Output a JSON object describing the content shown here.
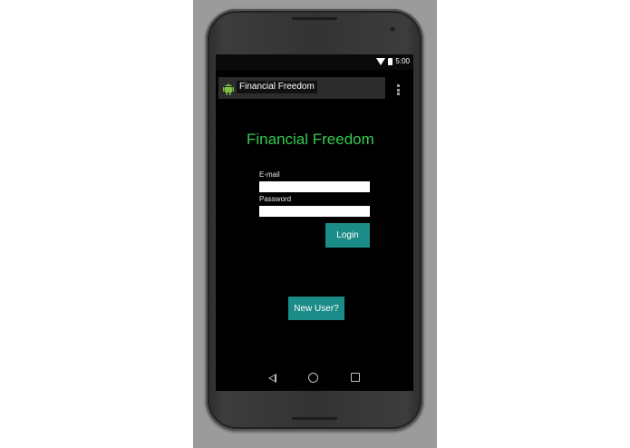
{
  "status_bar": {
    "wifi_icon": "wifi-icon",
    "battery_icon": "battery-icon",
    "time": "5:00"
  },
  "action_bar": {
    "app_icon": "android-icon",
    "title": "Financial Freedom",
    "overflow_icon": "overflow-menu-icon"
  },
  "main": {
    "heading": "Financial Freedom",
    "email_label": "E-mail",
    "email_value": "",
    "password_label": "Password",
    "password_value": "",
    "login_button": "Login",
    "new_user_button": "New User?"
  },
  "nav_bar": {
    "back_icon": "back-icon",
    "home_icon": "home-icon",
    "recents_icon": "recents-icon"
  },
  "colors": {
    "heading": "#35c94f",
    "button": "#1b8c88",
    "screen_bg": "#000000",
    "device_bg": "#9b9b9b"
  }
}
